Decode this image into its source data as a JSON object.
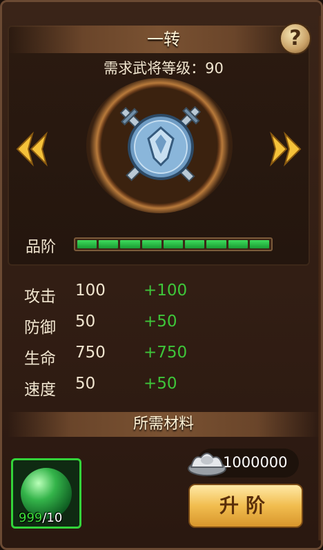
{
  "panel": {
    "title": "一转",
    "help_symbol": "?",
    "requirement": "需求武将等级：90"
  },
  "navigation": {
    "prev_icon": "double-chevron-left",
    "next_icon": "double-chevron-right"
  },
  "emblem": {
    "icon": "shield-crossed-swords-icon"
  },
  "grade": {
    "label": "品阶",
    "filled_segments": 9,
    "total_segments": 9
  },
  "stats": [
    {
      "label": "攻击",
      "value": "100",
      "bonus": "+100"
    },
    {
      "label": "防御",
      "value": "50",
      "bonus": "+50"
    },
    {
      "label": "生命",
      "value": "750",
      "bonus": "+750"
    },
    {
      "label": "速度",
      "value": "50",
      "bonus": "+50"
    }
  ],
  "materials": {
    "title": "所需材料",
    "item": {
      "icon": "green-jade-orb-icon",
      "have": "999",
      "need": "/10"
    },
    "silver": {
      "icon": "silver-ingot-icon",
      "amount": "1000000"
    }
  },
  "actions": {
    "upgrade_label": "升阶"
  },
  "colors": {
    "bonus_green": "#3ec63a",
    "grade_green": "#2fcf4d",
    "button_gold": "#f1bd4f"
  }
}
